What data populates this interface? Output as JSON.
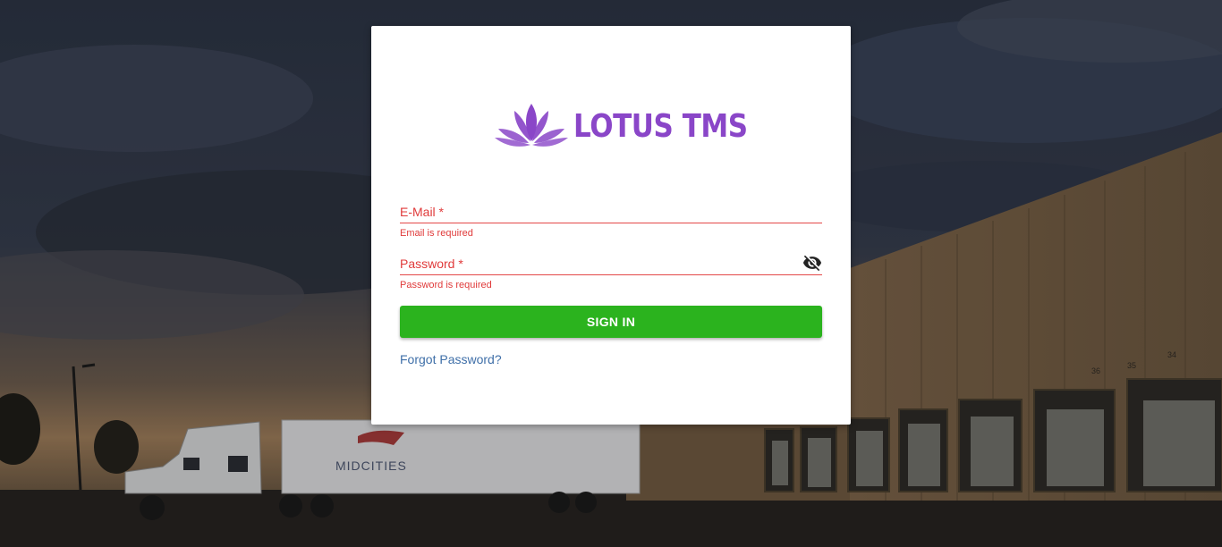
{
  "brand": {
    "name": "LOTUS TMS",
    "logo_color": "#8a46c8"
  },
  "background": {
    "trailer_text": "MIDCITIES",
    "dock_numbers": [
      "36",
      "35",
      "34"
    ]
  },
  "form": {
    "email": {
      "label": "E-Mail *",
      "value": "",
      "error": "Email is required"
    },
    "password": {
      "label": "Password *",
      "value": "",
      "error": "Password is required",
      "toggle_icon": "eye-off-icon"
    },
    "submit_label": "SIGN IN",
    "forgot_label": "Forgot Password?"
  },
  "colors": {
    "error": "#e03a3a",
    "primary_button": "#2bb31e",
    "link": "#3f6fa8"
  }
}
